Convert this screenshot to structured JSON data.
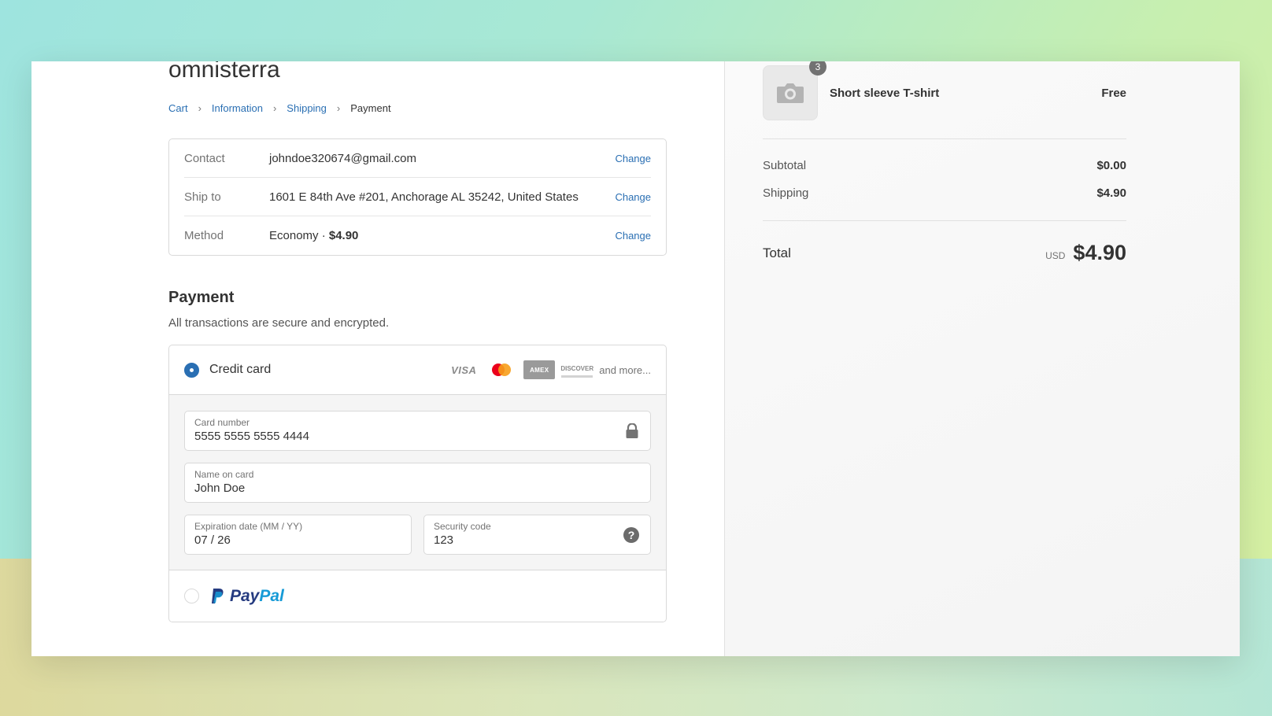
{
  "shop": {
    "name": "omnisterra"
  },
  "breadcrumb": [
    "Cart",
    "Information",
    "Shipping",
    "Payment"
  ],
  "review": {
    "contact": {
      "label": "Contact",
      "value": "johndoe320674@gmail.com",
      "action": "Change"
    },
    "ship_to": {
      "label": "Ship to",
      "value": "1601 E 84th Ave #201, Anchorage AL 35242, United States",
      "action": "Change"
    },
    "method": {
      "label": "Method",
      "value_prefix": "Economy · ",
      "value_price": "$4.90",
      "action": "Change"
    }
  },
  "payment": {
    "title": "Payment",
    "subtitle": "All transactions are secure and encrypted.",
    "credit_card": {
      "label": "Credit card",
      "selected": true,
      "brands": [
        "VISA",
        "mastercard",
        "AMEX",
        "DISCOVER"
      ],
      "and_more": "and more...",
      "fields": {
        "card_number": {
          "label": "Card number",
          "value": "5555 5555 5555 4444"
        },
        "name_on_card": {
          "label": "Name on card",
          "value": "John Doe"
        },
        "expiration": {
          "label": "Expiration date (MM / YY)",
          "value": "07 / 26"
        },
        "security_code": {
          "label": "Security code",
          "value": "123"
        }
      }
    },
    "paypal": {
      "selected": false,
      "logo_pay": "Pay",
      "logo_pal": "Pal"
    }
  },
  "summary": {
    "item": {
      "name": "Short sleeve T-shirt",
      "price": "Free",
      "quantity": "3"
    },
    "subtotal": {
      "label": "Subtotal",
      "value": "$0.00"
    },
    "shipping": {
      "label": "Shipping",
      "value": "$4.90"
    },
    "total": {
      "label": "Total",
      "currency": "USD",
      "value": "$4.90"
    }
  },
  "colors": {
    "link": "#2a6fb3",
    "text": "#333333",
    "muted": "#737373",
    "paypal_dark": "#253b80",
    "paypal_light": "#179bd7"
  }
}
